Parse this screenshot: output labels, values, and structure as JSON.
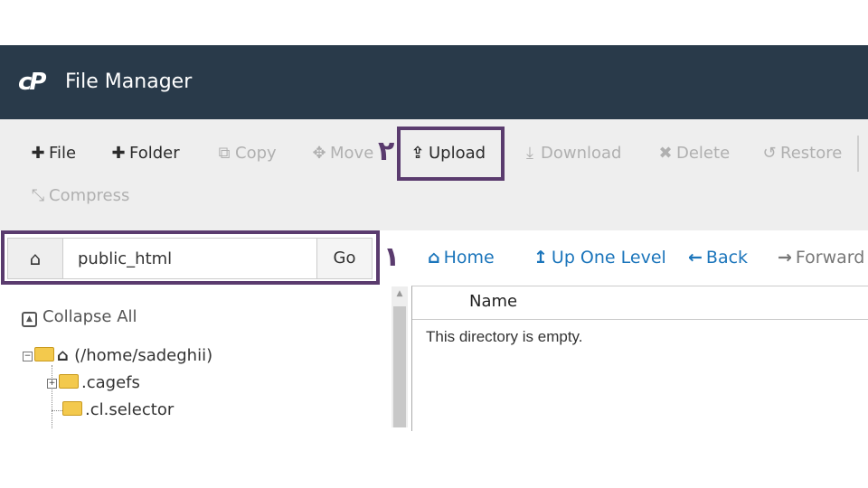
{
  "header": {
    "logo_text": "cP",
    "title": "File Manager",
    "background": "#293a4a"
  },
  "toolbar": {
    "file": {
      "icon": "plus-icon",
      "label": "File"
    },
    "folder": {
      "icon": "plus-icon",
      "label": "Folder"
    },
    "copy": {
      "icon": "copy-icon",
      "label": "Copy"
    },
    "move": {
      "icon": "move-icon",
      "label": "Move"
    },
    "upload": {
      "icon": "upload-icon",
      "label": "Upload"
    },
    "download": {
      "icon": "download-icon",
      "label": "Download"
    },
    "delete": {
      "icon": "times-icon",
      "label": "Delete"
    },
    "restore": {
      "icon": "undo-icon",
      "label": "Restore"
    },
    "compress": {
      "icon": "compress-icon",
      "label": "Compress"
    }
  },
  "annotations": {
    "label_1": "١",
    "label_2": "٢",
    "color": "#5a3b6e"
  },
  "path_bar": {
    "home_icon": "home-icon",
    "value": "public_html",
    "go_label": "Go"
  },
  "navigation": {
    "home": "Home",
    "up_one_level": "Up One Level",
    "back": "Back",
    "forward": "Forward"
  },
  "tree": {
    "collapse_all": "Collapse All",
    "root": "(/home/sadeghii)",
    "children": [
      ".cagefs",
      ".cl.selector"
    ]
  },
  "file_list": {
    "column_name": "Name",
    "empty_message": "This directory is empty."
  },
  "colors": {
    "link": "#1b75bb",
    "toolbar_bg": "#eeeeee"
  }
}
